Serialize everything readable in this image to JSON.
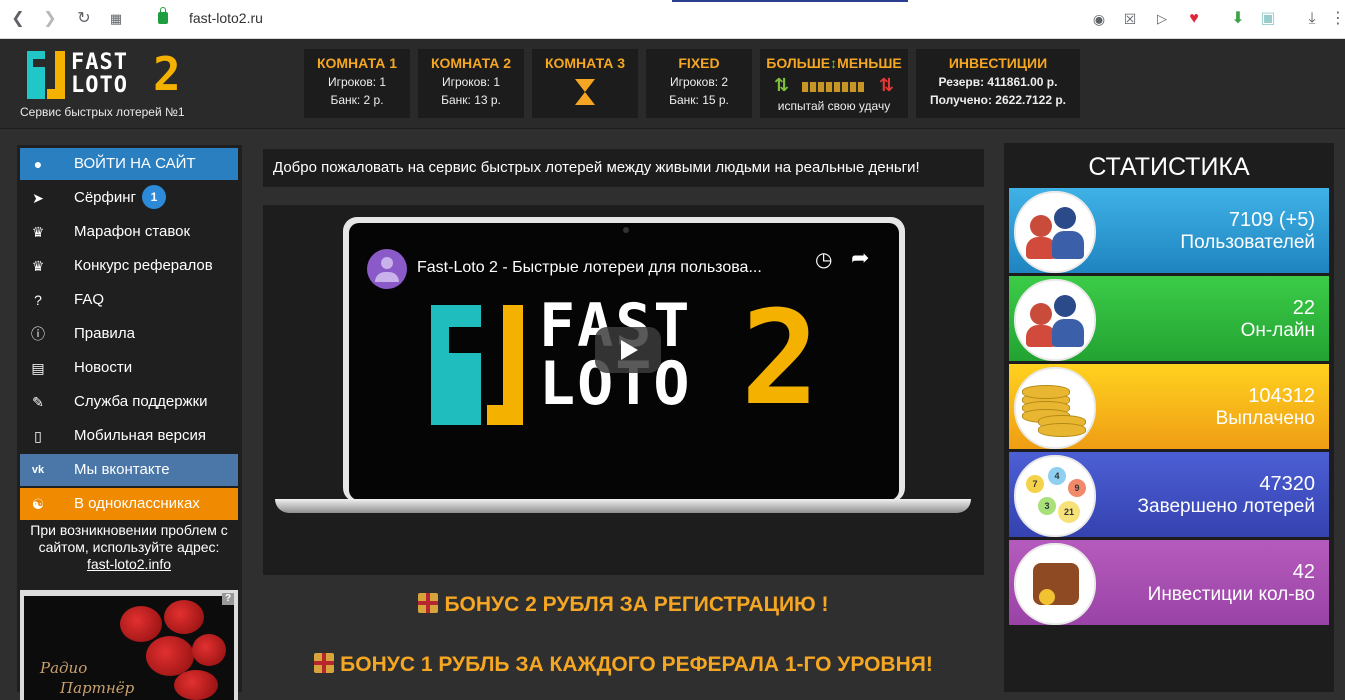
{
  "browser": {
    "url": "fast-loto2.ru"
  },
  "header": {
    "logo_line1": "FAST",
    "logo_line2": "LOTO",
    "logo_number": "2",
    "tagline": "Сервис быстрых лотерей №1",
    "rooms": [
      {
        "title": "КОМНАТА 1",
        "players": "Игроков: 1",
        "bank": "Банк: 2 р."
      },
      {
        "title": "КОМНАТА 2",
        "players": "Игроков: 1",
        "bank": "Банк: 13 р."
      },
      {
        "title": "КОМНАТА 3"
      },
      {
        "title": "FIXED",
        "players": "Игроков: 2",
        "bank": "Банк: 15 р."
      }
    ],
    "more_less": {
      "title_left": "БОЛЬШЕ",
      "title_arrow": "↕",
      "title_right": "МЕНЬШЕ",
      "caption": "испытай свою удачу"
    },
    "investments": {
      "title": "ИНВЕСТИЦИИ",
      "reserve": "Резерв: 411861.00 р.",
      "received": "Получено: 2622.7122 р."
    }
  },
  "sidebar": {
    "items": [
      {
        "label": "ВОЙТИ НА САЙТ",
        "icon": "user-icon",
        "color": "#2a7fc0"
      },
      {
        "label": "Сёрфинг",
        "icon": "cursor-icon",
        "badge": "1"
      },
      {
        "label": "Марафон ставок",
        "icon": "trophy-icon"
      },
      {
        "label": "Конкурс рефералов",
        "icon": "trophy-icon"
      },
      {
        "label": "FAQ",
        "icon": "question-icon"
      },
      {
        "label": "Правила",
        "icon": "info-icon"
      },
      {
        "label": "Новости",
        "icon": "news-icon"
      },
      {
        "label": "Служба поддержки",
        "icon": "pencil-icon"
      },
      {
        "label": "Мобильная версия",
        "icon": "mobile-icon"
      },
      {
        "label": "Мы вконтакте",
        "icon": "vk-icon",
        "color": "#4a76a8"
      },
      {
        "label": "В одноклассниках",
        "icon": "ok-icon",
        "color": "#f08a00"
      }
    ],
    "note": "При возникновении проблем с сайтом, используйте адрес:",
    "mirror_link": "fast-loto2.info",
    "radio_text_1": "Радио",
    "radio_text_2": "Партнёр"
  },
  "main": {
    "welcome": "Добро пожаловать на сервис быстрых лотерей между живыми людьми на реальные деньги!",
    "video_title": "Fast-Loto 2 - Быстрые лотереи для пользова...",
    "video_logo_line1": "FAST",
    "video_logo_line2": "LOTO",
    "video_logo_number": "2",
    "bonus1": "БОНУС 2 РУБЛЯ ЗА РЕГИСТРАЦИЮ !",
    "bonus2": "БОНУС 1 РУБЛЬ ЗА КАЖДОГО РЕФЕРАЛА 1-ГО УРОВНЯ!"
  },
  "stats": {
    "title": "СТАТИСТИКА",
    "cards": [
      {
        "value": "7109 (+5)",
        "label": "Пользователей",
        "icon": "users-icon",
        "color": "#2a9bd6"
      },
      {
        "value": "22",
        "label": "Он-лайн",
        "icon": "users-online-icon",
        "color": "#2bba3c"
      },
      {
        "value": "104312",
        "label": "Выплачено",
        "icon": "coins-icon",
        "color": "#f3b51b"
      },
      {
        "value": "47320",
        "label": "Завершено лотерей",
        "icon": "lottery-balls-icon",
        "color": "#4051c8"
      },
      {
        "value": "42",
        "label": "Инвестиции кол-во",
        "icon": "wallet-icon",
        "color": "#a94fb1"
      }
    ]
  }
}
